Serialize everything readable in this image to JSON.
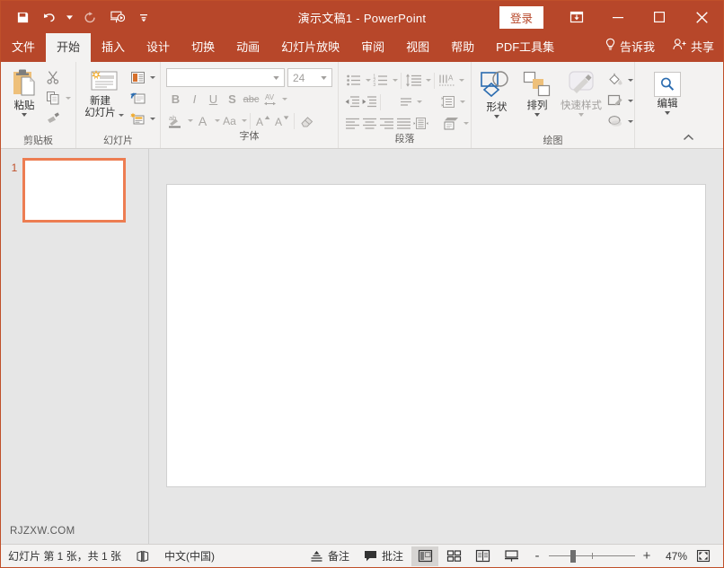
{
  "titlebar": {
    "document_title": "演示文稿1  -  PowerPoint",
    "signin_label": "登录",
    "quick_access": [
      {
        "name": "save-icon",
        "label": "保存"
      },
      {
        "name": "undo-icon",
        "label": "撤消"
      },
      {
        "name": "redo-icon",
        "label": "恢复"
      },
      {
        "name": "start-presentation-icon",
        "label": "从头开始"
      },
      {
        "name": "customize-quick-access-icon",
        "label": "自定义快速访问工具栏"
      }
    ],
    "window_controls": [
      {
        "name": "ribbon-display-options-icon",
        "label": "功能区显示选项"
      },
      {
        "name": "minimize-icon",
        "label": "最小化"
      },
      {
        "name": "maximize-icon",
        "label": "最大化"
      },
      {
        "name": "close-icon",
        "label": "关闭"
      }
    ],
    "colors": {
      "background": "#b7472a",
      "text": "#ffffff"
    }
  },
  "tabs": [
    {
      "label": "文件",
      "active": false
    },
    {
      "label": "开始",
      "active": true
    },
    {
      "label": "插入",
      "active": false
    },
    {
      "label": "设计",
      "active": false
    },
    {
      "label": "切换",
      "active": false
    },
    {
      "label": "动画",
      "active": false
    },
    {
      "label": "幻灯片放映",
      "active": false
    },
    {
      "label": "审阅",
      "active": false
    },
    {
      "label": "视图",
      "active": false
    },
    {
      "label": "帮助",
      "active": false
    },
    {
      "label": "PDF工具集",
      "active": false
    }
  ],
  "tell_me": {
    "label": "告诉我"
  },
  "share": {
    "label": "共享"
  },
  "ribbon": {
    "clipboard": {
      "title": "剪贴板",
      "paste_label": "粘贴",
      "cut_label": "剪切",
      "copy_label": "复制",
      "format_painter_label": "格式刷"
    },
    "slides": {
      "title": "幻灯片",
      "new_slide_label": "新建\n幻灯片",
      "new_slide_line1": "新建",
      "new_slide_line2": "幻灯片",
      "layout_label": "版式",
      "reset_label": "重置",
      "section_label": "节"
    },
    "font": {
      "title": "字体",
      "font_name_value": "",
      "font_name_placeholder": "",
      "font_size_value": "24",
      "bold_label": "B",
      "italic_label": "I",
      "underline_label": "U",
      "shadow_label": "S",
      "strikethrough_label": "abc",
      "char_spacing_label": "AV",
      "text_highlight_label": "ab",
      "font_color_label": "A",
      "change_case_label": "Aa",
      "increase_size_label": "A",
      "decrease_size_label": "A",
      "clear_format_label": "清除所有格式"
    },
    "paragraph": {
      "title": "段落",
      "bullets_label": "项目符号",
      "numbering_label": "编号",
      "line_spacing_label": "行距",
      "text_direction_label": "文字方向",
      "decrease_indent_label": "减少缩进量",
      "increase_indent_label": "增加缩进量",
      "align_text_label": "对齐文本",
      "columns_label": "分栏",
      "align_left_label": "左对齐",
      "align_center_label": "居中",
      "align_right_label": "右对齐",
      "justify_label": "两端对齐",
      "convert_smartart_label": "转换为 SmartArt"
    },
    "drawing": {
      "title": "绘图",
      "shapes_label": "形状",
      "arrange_label": "排列",
      "quick_styles_label": "快速样式",
      "shape_fill_label": "形状填充",
      "shape_outline_label": "形状轮廓",
      "shape_effects_label": "形状效果"
    },
    "editing": {
      "title": "编辑",
      "edit_label": "编辑"
    },
    "collapse_label": "折叠功能区"
  },
  "thumbnails": {
    "slides": [
      {
        "number": "1",
        "selected": true
      }
    ]
  },
  "watermark": {
    "text": "RJZXW.COM"
  },
  "statusbar": {
    "slide_count_text": "幻灯片 第 1 张，共 1 张",
    "accessibility_label": "辅助功能",
    "language": "中文(中国)",
    "notes_label": "备注",
    "comments_label": "批注",
    "views": [
      {
        "name": "view-normal",
        "label": "普通视图",
        "active": true
      },
      {
        "name": "view-slide-sorter",
        "label": "幻灯片浏览",
        "active": false
      },
      {
        "name": "view-reading",
        "label": "阅读视图",
        "active": false
      },
      {
        "name": "view-slideshow",
        "label": "幻灯片放映",
        "active": false
      }
    ],
    "zoom_out_label": "-",
    "zoom_in_label": "+",
    "zoom_level": "47%",
    "fit_window_label": "使幻灯片适应当前窗口"
  },
  "colors": {
    "accent": "#b7472a",
    "thumb_selected_border": "#ed7d52",
    "ribbon_bg": "#f3f2f1",
    "workspace_bg": "#e6e6e6"
  }
}
